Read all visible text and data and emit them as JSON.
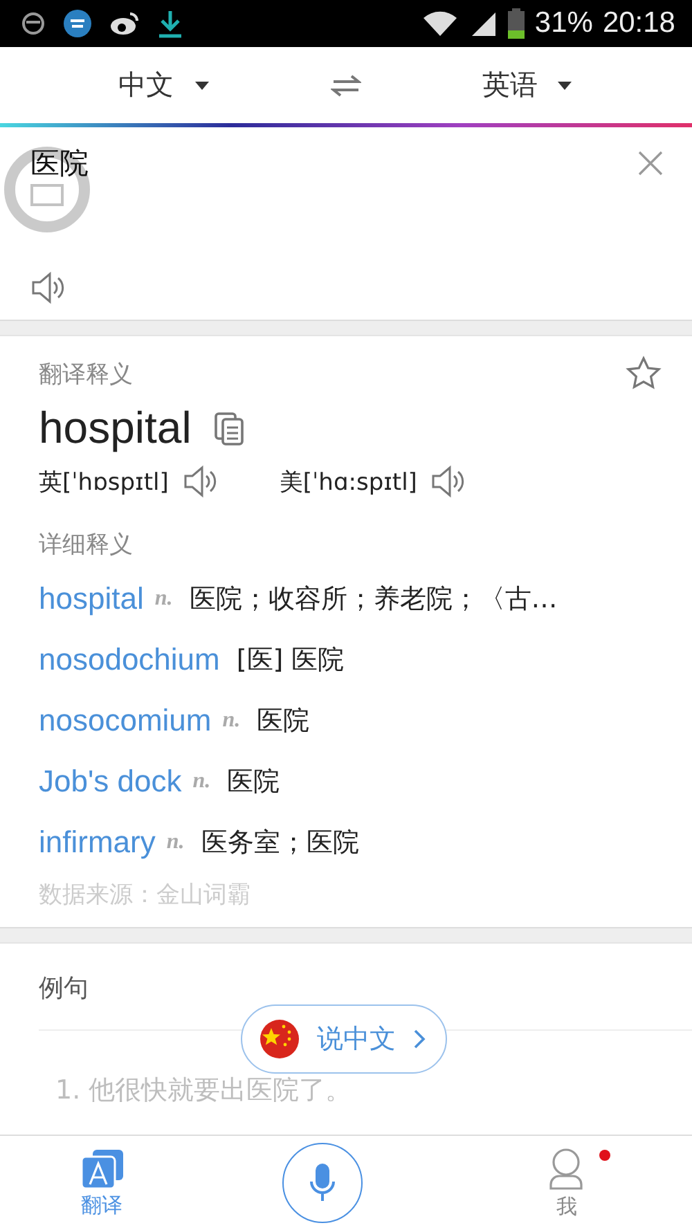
{
  "status_bar": {
    "battery": "31%",
    "time": "20:18"
  },
  "language_bar": {
    "source": "中文",
    "target": "英语"
  },
  "input": {
    "value": "医院"
  },
  "result": {
    "section_title": "翻译释义",
    "starred": false,
    "word": "hospital",
    "phonetics": [
      {
        "text": "英[ˈhɒspɪtl]"
      },
      {
        "text": "美[ˈhɑ:spɪtl]"
      }
    ],
    "details_title": "详细释义",
    "entries": [
      {
        "word": "hospital",
        "pos": "n.",
        "meaning": "医院；收容所；养老院；〈古…"
      },
      {
        "word": "nosodochium",
        "meaning": "[医] 医院"
      },
      {
        "word": "nosocomium",
        "pos": "n.",
        "meaning": "医院"
      },
      {
        "word": "Job's dock",
        "pos": "n.",
        "meaning": "医院"
      },
      {
        "word": "infirmary",
        "pos": "n.",
        "meaning": "医务室；医院"
      }
    ],
    "source": "数据来源：金山词霸"
  },
  "examples": {
    "title": "例句",
    "first": "1. 他很快就要出医院了。"
  },
  "speak_button": {
    "label": "说中文"
  },
  "bottom_nav": [
    {
      "label": "翻译",
      "kind": "translate",
      "selected": true
    },
    {
      "kind": "mic",
      "selected": false
    },
    {
      "label": "我",
      "kind": "me",
      "selected": false,
      "badge": true
    }
  ]
}
